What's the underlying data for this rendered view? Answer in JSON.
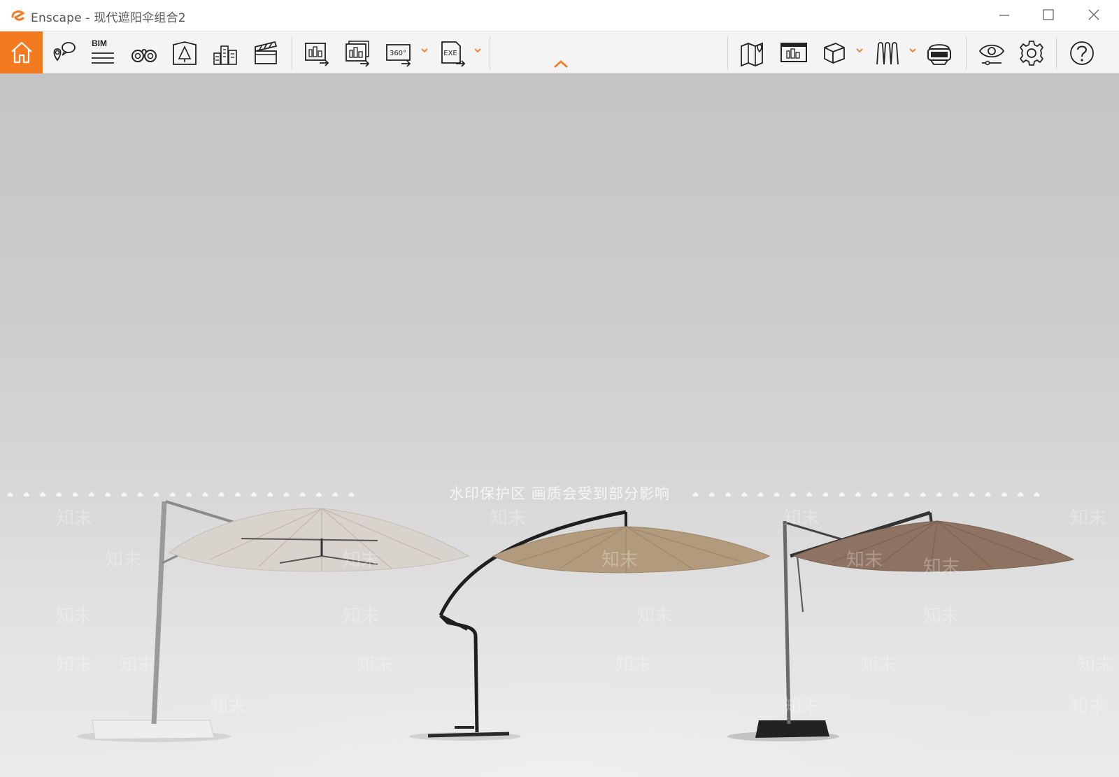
{
  "window": {
    "app_name": "Enscape",
    "separator": " - ",
    "document_name": "现代遮阳伞组合2"
  },
  "toolbar": {
    "bim_label": "BIM",
    "accent_color": "#f37a1f",
    "left_buttons": [
      "home-icon",
      "views-icon",
      "bim-icon",
      "binoculars-icon",
      "atlas-icon",
      "buildings-icon",
      "video-editor-icon"
    ],
    "export_buttons": [
      "screenshot-icon",
      "batch-render-icon",
      "panorama-icon",
      "exe-export-icon"
    ],
    "right_buttons": [
      "map-icon",
      "presentation-icon",
      "cube-icon",
      "asset-library-icon",
      "vr-headset-icon",
      "visual-settings-icon",
      "gear-icon",
      "help-icon"
    ],
    "panorama_label": "360°",
    "exe_label": "EXE"
  },
  "viewport": {
    "watermark_banner": "水印保护区   画质会受到部分影响",
    "watermark_tile": "知末",
    "umbrella_colors": [
      "#d8d3cd",
      "#b29a7c",
      "#8e7363"
    ]
  }
}
